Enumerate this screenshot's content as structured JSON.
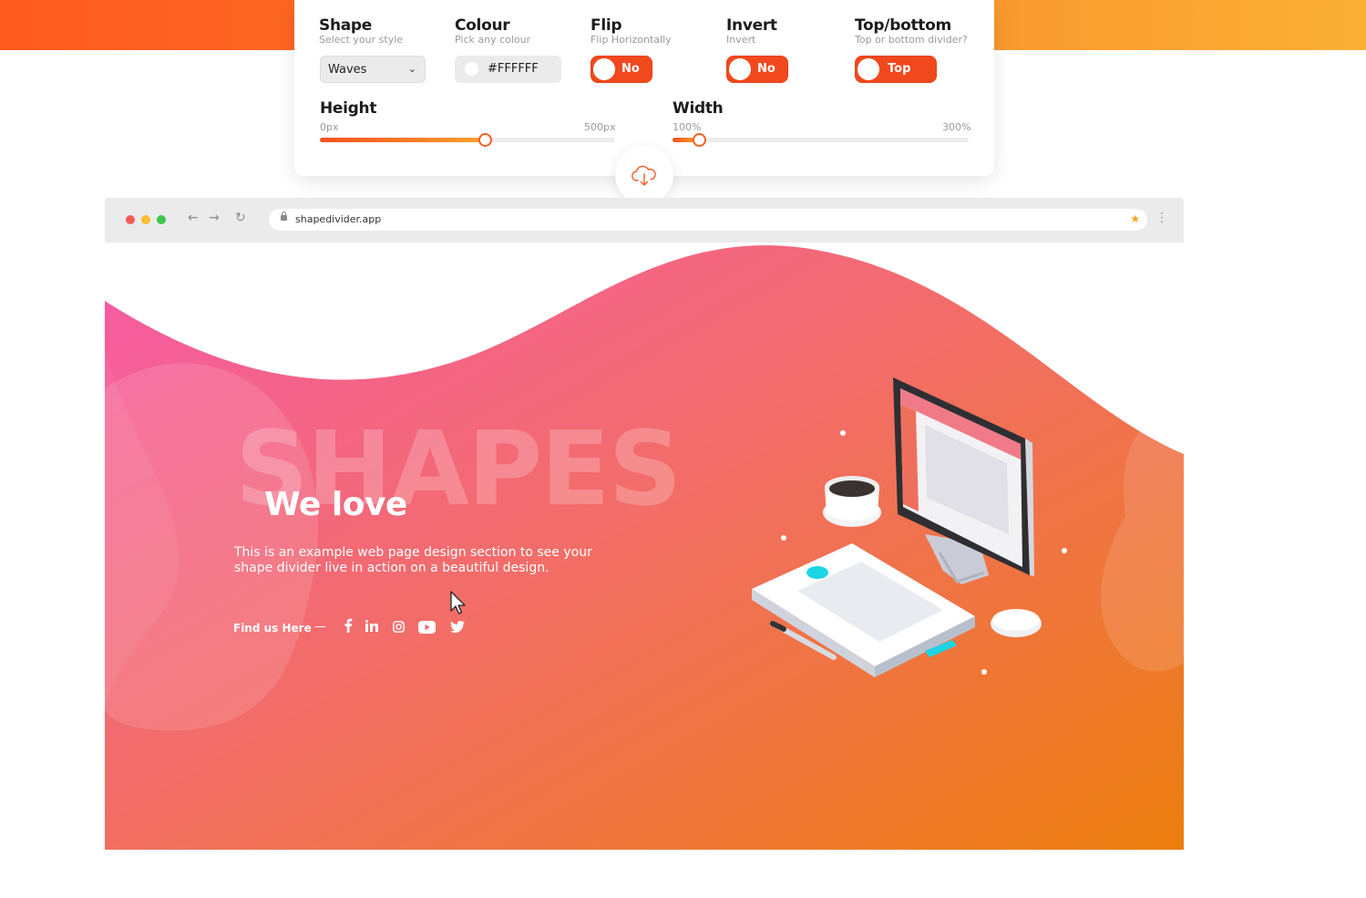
{
  "panel": {
    "shape": {
      "label": "Shape",
      "sub": "Select your style",
      "value": "Waves"
    },
    "colour": {
      "label": "Colour",
      "sub": "Pick any colour",
      "value": "#FFFFFF"
    },
    "flip": {
      "label": "Flip",
      "sub": "Flip Horizontally",
      "value": "No"
    },
    "invert": {
      "label": "Invert",
      "sub": "Invert",
      "value": "No"
    },
    "topbottom": {
      "label": "Top/bottom",
      "sub": "Top or bottom divider?",
      "value": "Top"
    },
    "height": {
      "label": "Height",
      "min": "0px",
      "max": "500px",
      "level": 0.56
    },
    "width": {
      "label": "Width",
      "min": "100%",
      "max": "300%",
      "level": 0.09
    }
  },
  "browser": {
    "url": "shapedivider.app"
  },
  "hero": {
    "big_word": "SHAPES",
    "headline": "We love",
    "description": "This is an example web page design section to see your shape divider live in action on a beautiful design.",
    "find_label": "Find us Here",
    "dash": "—"
  },
  "colors": {
    "accent": "#f2481d",
    "gradient_start": "#f65aa0",
    "gradient_end": "#ec7e0d"
  },
  "icons": [
    "chevron-down-icon",
    "lock-icon",
    "star-icon",
    "kebab-menu-icon",
    "cloud-download-icon",
    "facebook-icon",
    "linkedin-icon",
    "instagram-icon",
    "youtube-icon",
    "twitter-icon",
    "mouse-cursor-icon"
  ]
}
